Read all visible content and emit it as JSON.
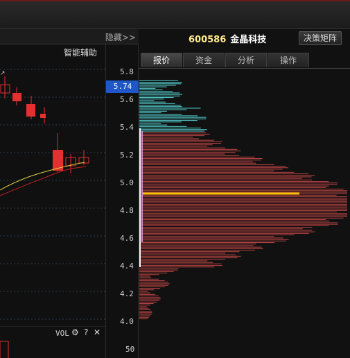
{
  "left_panel": {
    "hide_label": "隐藏>>",
    "assist_label": "智能辅助",
    "vol_label": "VOL",
    "vol_icons": [
      "gear-icon",
      "help-icon",
      "close-icon"
    ]
  },
  "axis": {
    "price_ticks": [
      "5.8",
      "5.6",
      "5.4",
      "5.2",
      "5.0",
      "4.8",
      "4.6",
      "4.4",
      "4.2",
      "4.0"
    ],
    "current_price": "5.74",
    "volume_tick": "50"
  },
  "right_panel": {
    "stock_code": "600586",
    "stock_name": "金晶科技",
    "matrix_button": "决策矩阵",
    "tabs": [
      "报价",
      "资金",
      "分析",
      "操作"
    ],
    "active_tab": "报价"
  },
  "colors": {
    "profit_chips": "#4fc3c3",
    "loss_chips": "#b04040",
    "avg_cost_line": "#f0c000",
    "current_price_tag": "#1f56c8",
    "candle_up": "#e53030",
    "ma_short": "#e0d040",
    "ma_long": "#c02020"
  },
  "chip_distribution": {
    "price_min": 4.0,
    "price_max": 5.8,
    "current_price": 5.74,
    "average_cost": 4.93,
    "profit_band": [
      5.38,
      5.75
    ],
    "concentration_bracket_90": [
      4.4,
      5.4
    ],
    "concentration_bracket_70": [
      4.58,
      5.38
    ]
  }
}
